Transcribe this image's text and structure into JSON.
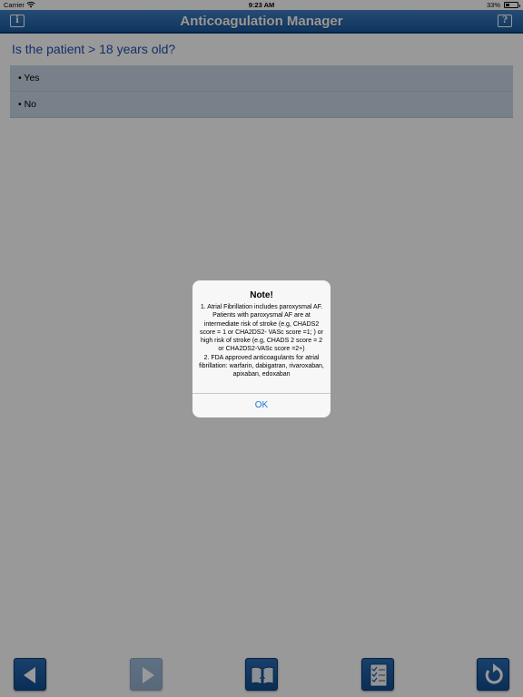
{
  "status_bar": {
    "carrier": "Carrier",
    "time": "9:23 AM",
    "battery_percent": "33%",
    "battery_level": 0.33
  },
  "nav": {
    "title": "Anticoagulation Manager",
    "info_icon": "info-icon",
    "help_icon": "help-icon",
    "info_glyph": "i",
    "help_glyph": "?"
  },
  "question": {
    "text": "Is the patient > 18 years old?",
    "options": [
      {
        "label": "• Yes"
      },
      {
        "label": "• No"
      }
    ]
  },
  "toolbar": {
    "buttons": [
      {
        "icon": "back-arrow-icon",
        "enabled": true
      },
      {
        "icon": "forward-arrow-icon",
        "enabled": false
      },
      {
        "icon": "book-icon",
        "enabled": true
      },
      {
        "icon": "checklist-icon",
        "enabled": true
      },
      {
        "icon": "restart-icon",
        "enabled": true
      }
    ]
  },
  "alert": {
    "title": "Note!",
    "message": "1. Atrial Fibrillation includes paroxysmal AF. Patients with paroxysmal AF are at intermediate risk of stroke (e.g, CHADS2 score = 1 or CHA2DS2- VASc score =1; ) or high risk of stroke (e.g, CHADS 2 score = 2 or CHA2DS2-VASc score =2+)\n2. FDA approved anticoagulants for atrial fibrillation: warfarin, dabigatran, rivaroxaban, apixaban, edoxaban",
    "ok_label": "OK"
  },
  "colors": {
    "nav_blue": "#1a5aa0",
    "question_blue": "#1f4fb4",
    "option_bg": "#c9d7e6",
    "link_blue": "#1a73d9"
  }
}
